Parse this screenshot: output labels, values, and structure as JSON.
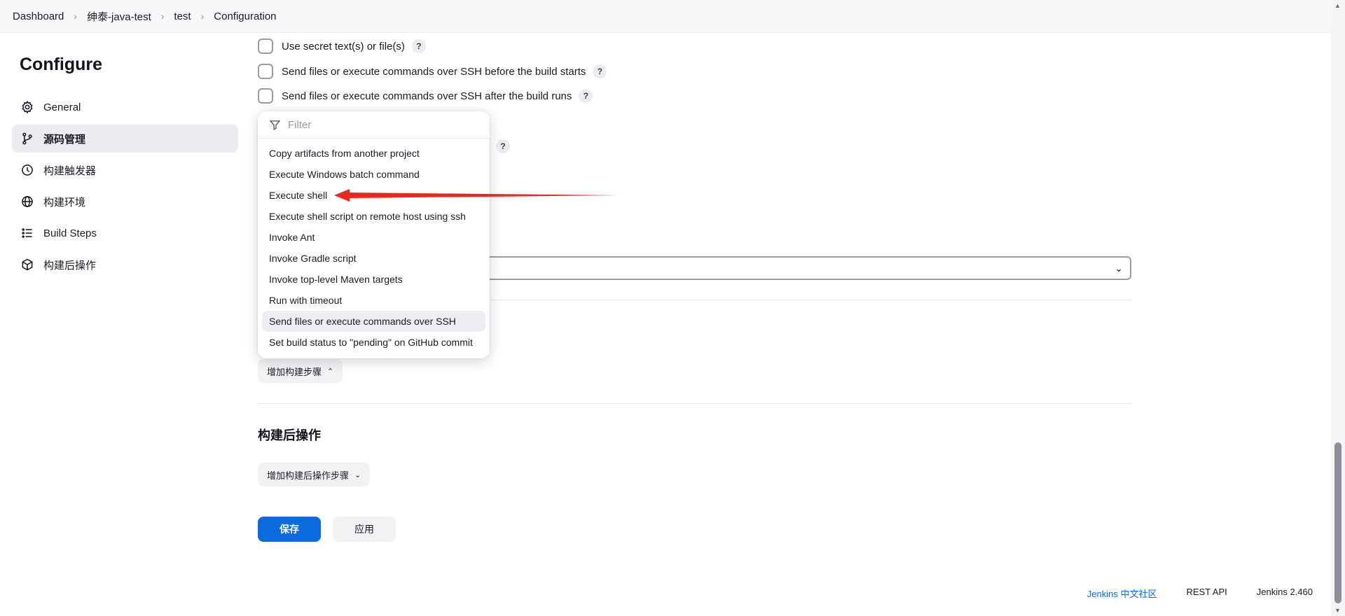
{
  "breadcrumb": [
    "Dashboard",
    "绅泰-java-test",
    "test",
    "Configuration"
  ],
  "sidebar": {
    "title": "Configure",
    "items": [
      {
        "label": "General",
        "icon": "gear-icon"
      },
      {
        "label": "源码管理",
        "icon": "branch-icon",
        "active": true
      },
      {
        "label": "构建触发器",
        "icon": "clock-icon"
      },
      {
        "label": "构建环境",
        "icon": "globe-icon"
      },
      {
        "label": "Build Steps",
        "icon": "list-icon"
      },
      {
        "label": "构建后操作",
        "icon": "package-icon"
      }
    ]
  },
  "options": [
    {
      "label": "Use secret text(s) or file(s)"
    },
    {
      "label": "Send files or execute commands over SSH before the build starts"
    },
    {
      "label": "Send files or execute commands over SSH after the build runs"
    }
  ],
  "help_label": "?",
  "dropdown": {
    "filter_placeholder": "Filter",
    "items": [
      "Copy artifacts from another project",
      "Execute Windows batch command",
      "Execute shell",
      "Execute shell script on remote host using ssh",
      "Invoke Ant",
      "Invoke Gradle script",
      "Invoke top-level Maven targets",
      "Run with timeout",
      "Send files or execute commands over SSH",
      "Set build status to \"pending\" on GitHub commit"
    ],
    "hovered_item": "Send files or execute commands over SSH",
    "highlighted_item": "Execute shell"
  },
  "add_build_step_label": "增加构建步骤",
  "post_build": {
    "title": "构建后操作",
    "add_label": "增加构建后操作步骤"
  },
  "buttons": {
    "save": "保存",
    "apply": "应用"
  },
  "footer": {
    "community": "Jenkins 中文社区",
    "rest_api": "REST API",
    "version": "Jenkins 2.460"
  },
  "colors": {
    "accent": "#0b6bde",
    "annotation_arrow": "#e8281f",
    "active_sidebar_bg": "#ebebf0"
  }
}
